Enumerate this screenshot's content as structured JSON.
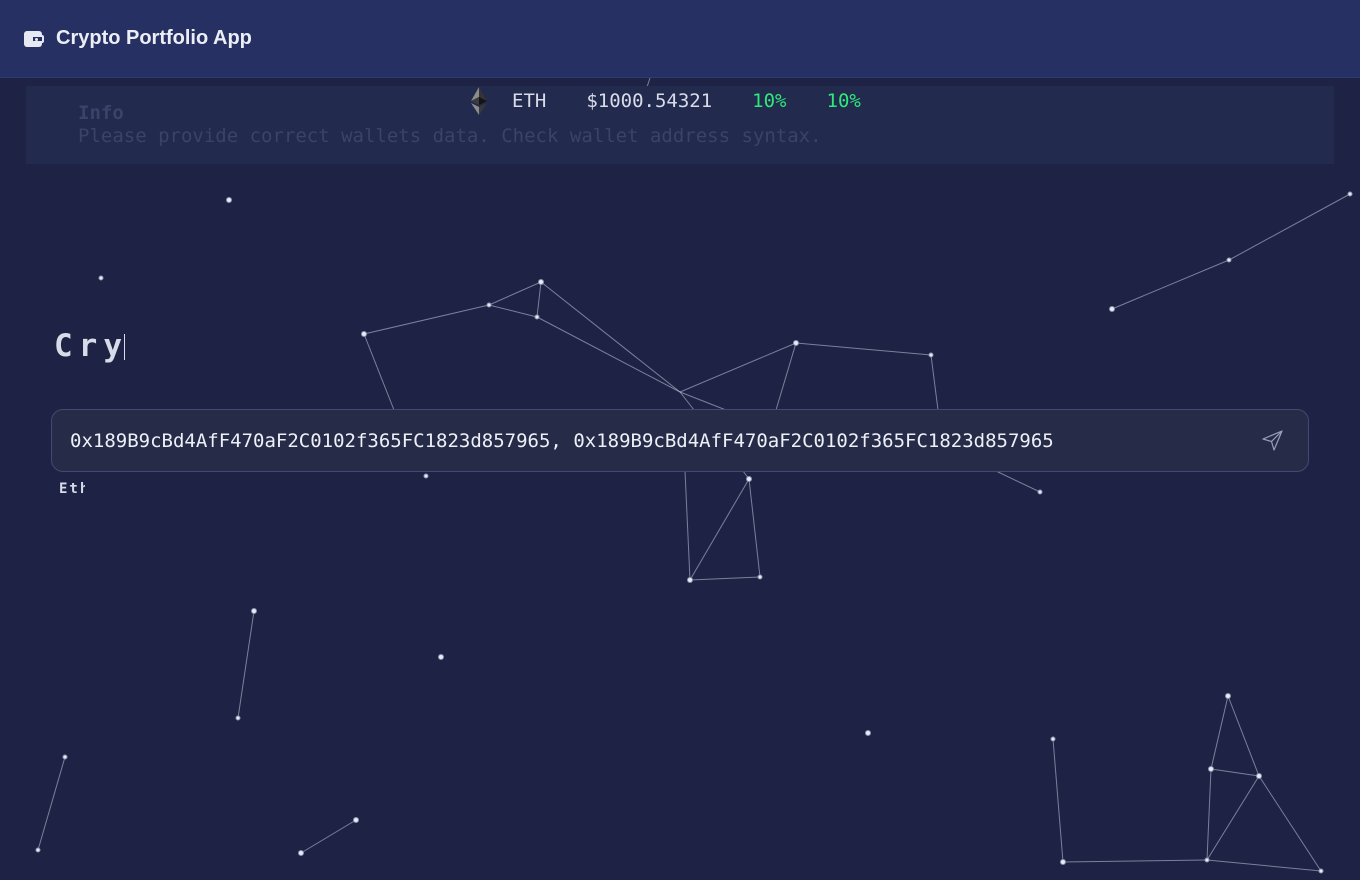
{
  "header": {
    "title": "Crypto Portfolio App",
    "icon": "wallet-icon"
  },
  "info_banner": {
    "title": "Info",
    "message": "Please provide correct wallets data. Check wallet address syntax."
  },
  "ticker": {
    "icon": "ethereum-icon",
    "symbol": "ETH",
    "price": "$1000.54321",
    "change_1": "10%",
    "change_2": "10%",
    "change_color": "#2ee879"
  },
  "headline": {
    "typed_text": "Cry"
  },
  "wallet_input": {
    "value": "0x189B9cBd4AfF470aF2C0102f365FC1823d857965, 0x189B9cBd4AfF470aF2C0102f365FC1823d857965",
    "send_icon": "send-icon"
  },
  "network_label": "Eth",
  "colors": {
    "background": "#1e2345",
    "header": "#273062",
    "accent_positive": "#2ee879"
  }
}
